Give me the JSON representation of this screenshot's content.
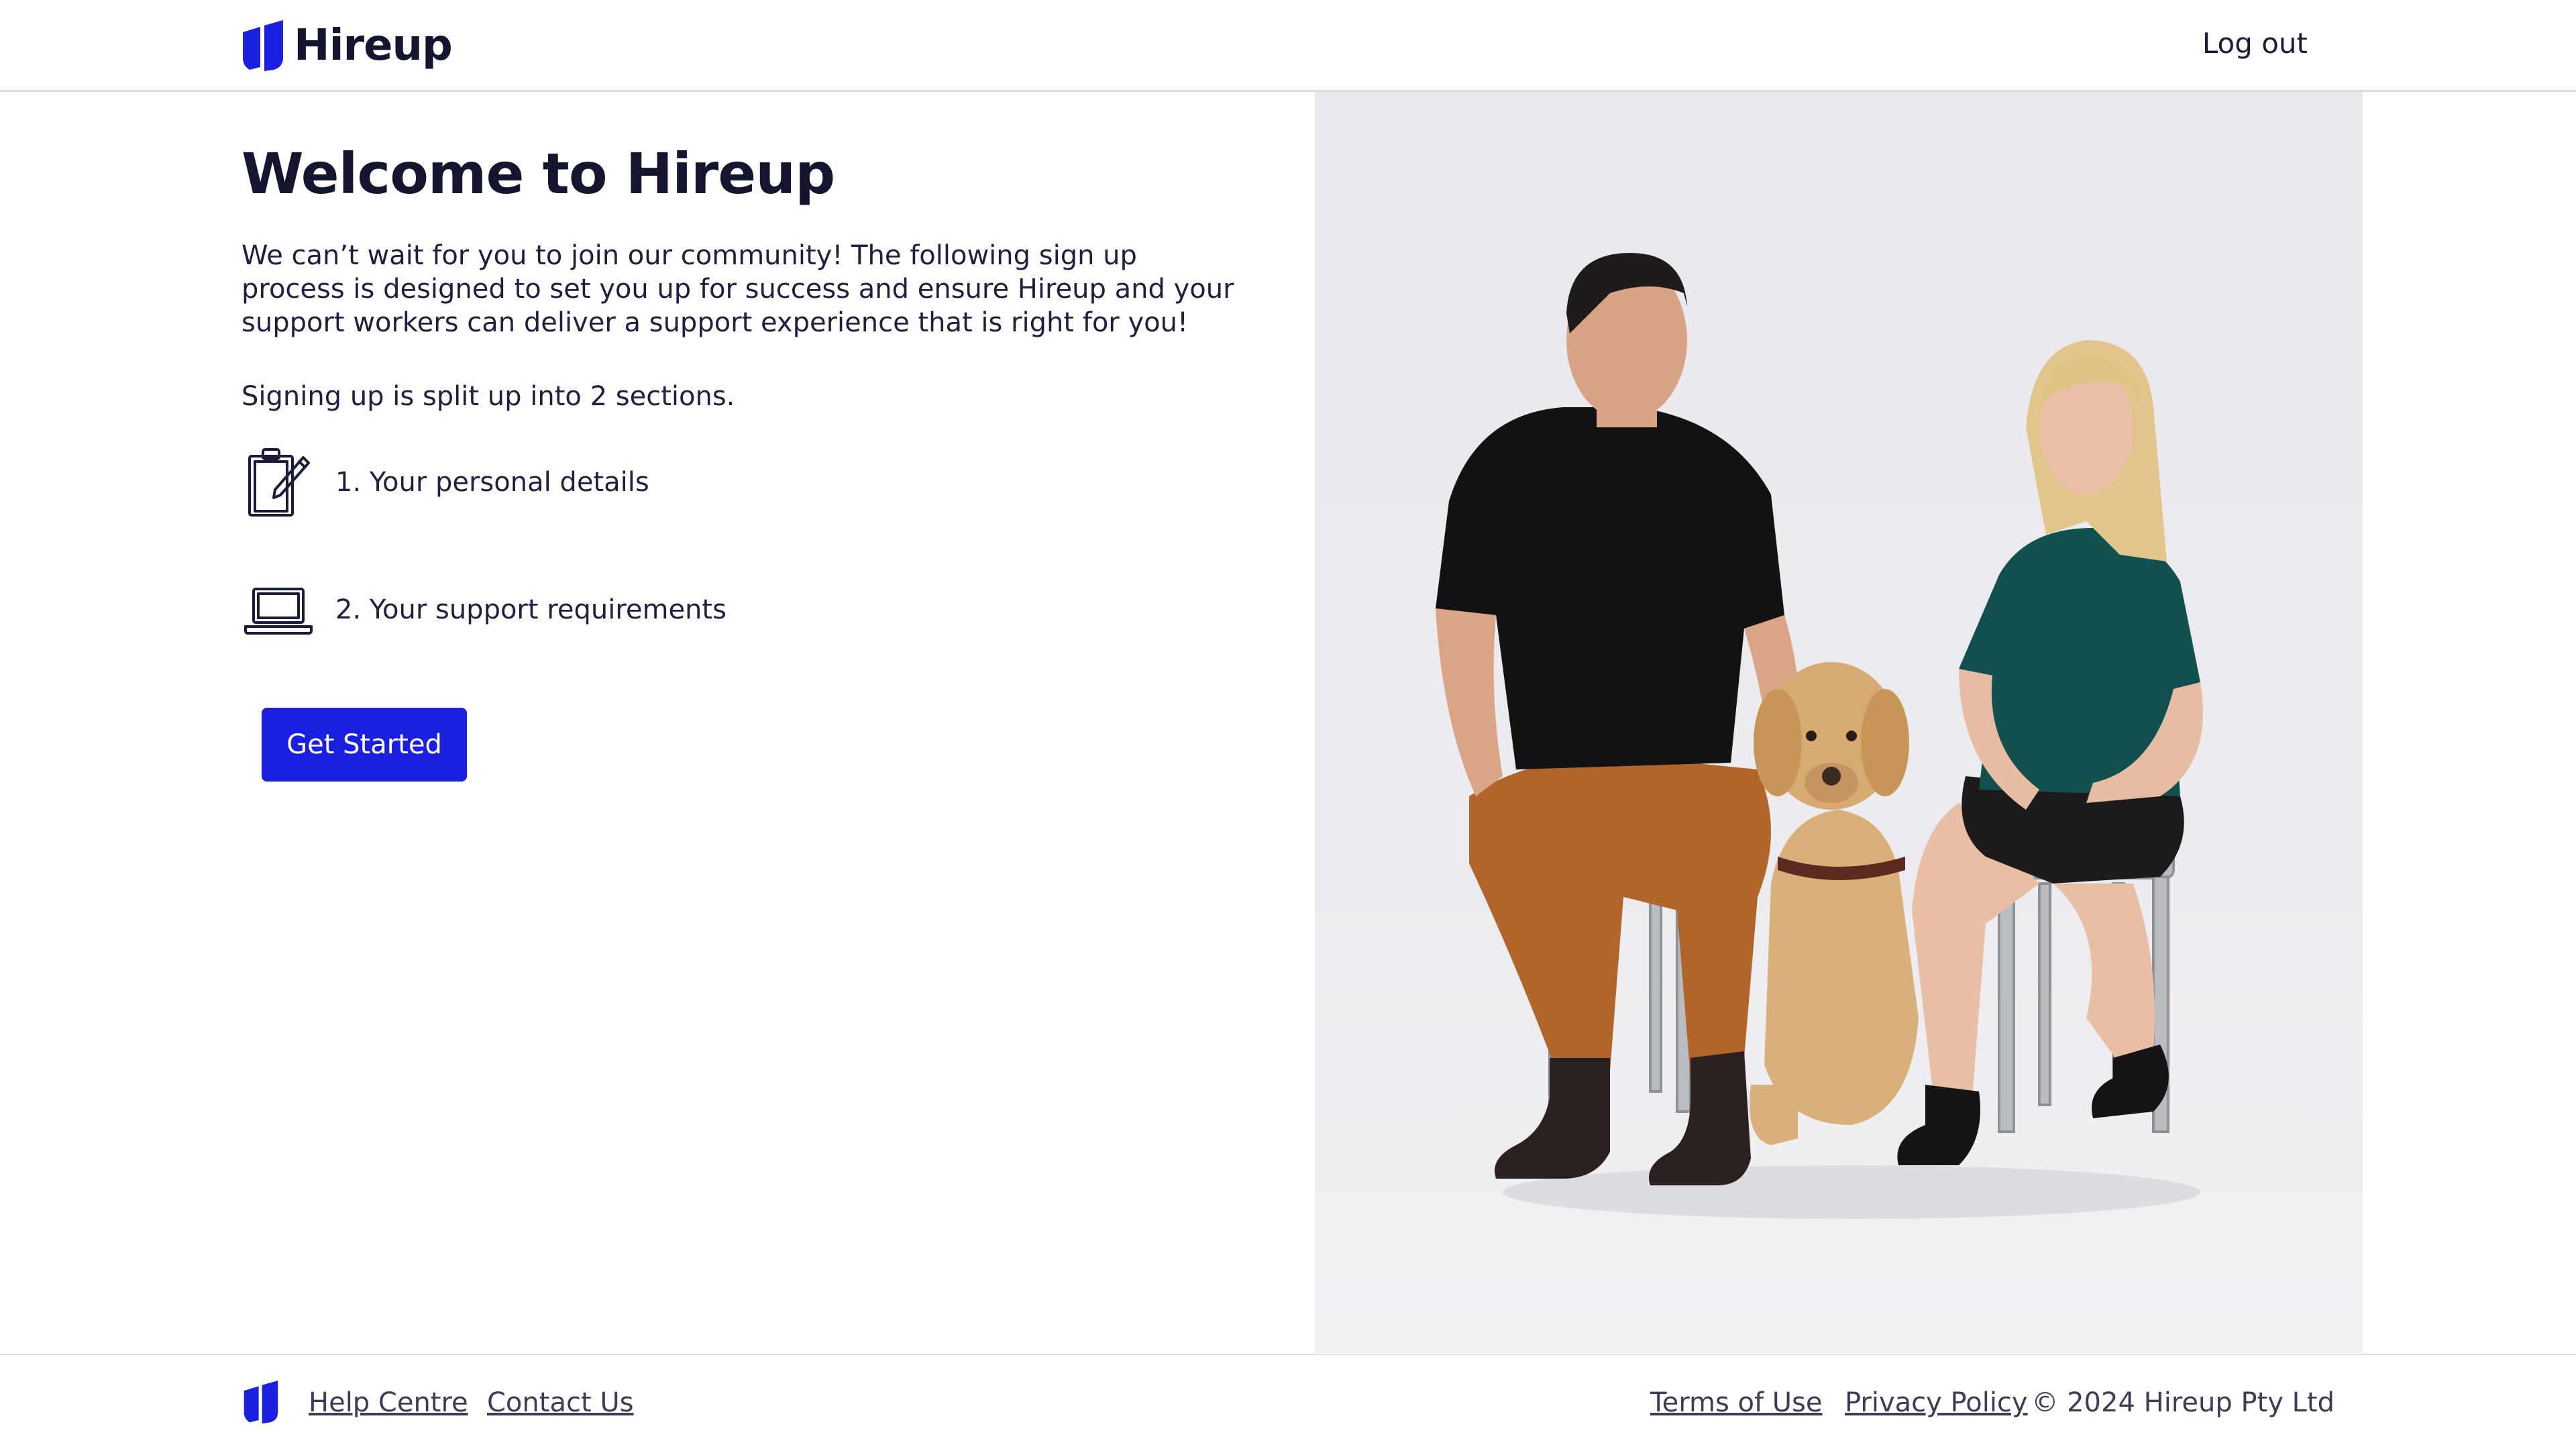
{
  "header": {
    "logo_text": "Hireup",
    "logout_label": "Log out"
  },
  "main": {
    "title": "Welcome to Hireup",
    "intro": "We can’t wait for you to join our community! The following sign up process is designed to set you up for success and ensure Hireup and your support workers can deliver a support experience that is right for you!",
    "split_text": "Signing up is split up into 2 sections.",
    "steps": [
      {
        "label": "1. Your personal details",
        "icon": "clipboard-pencil-icon"
      },
      {
        "label": "2. Your support requirements",
        "icon": "laptop-icon"
      }
    ],
    "cta_label": "Get Started"
  },
  "footer": {
    "links_left": [
      "Help Centre",
      "Contact Us"
    ],
    "links_right": [
      "Terms of Use",
      "Privacy Policy"
    ],
    "copyright": "© 2024 Hireup Pty Ltd"
  },
  "colors": {
    "brand": "#1a1fe0",
    "text_dark": "#14162f",
    "photo_bg": "#ebebef"
  }
}
